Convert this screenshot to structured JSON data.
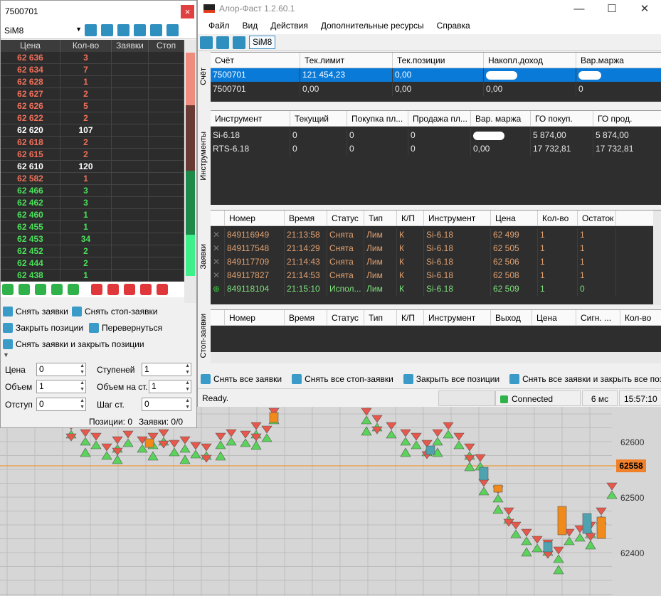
{
  "dom": {
    "title": "7500701",
    "close": "×",
    "symbol": "SiM8",
    "headers": [
      "Цена",
      "Кол-во",
      "Заявки",
      "Стоп"
    ],
    "rows": [
      {
        "price": "62 636",
        "qty": "3",
        "side": "ask"
      },
      {
        "price": "62 634",
        "qty": "7",
        "side": "ask"
      },
      {
        "price": "62 628",
        "qty": "1",
        "side": "ask"
      },
      {
        "price": "62 627",
        "qty": "2",
        "side": "ask"
      },
      {
        "price": "62 626",
        "qty": "5",
        "side": "ask"
      },
      {
        "price": "62 622",
        "qty": "2",
        "side": "ask"
      },
      {
        "price": "62 620",
        "qty": "107",
        "side": "big"
      },
      {
        "price": "62 618",
        "qty": "2",
        "side": "ask"
      },
      {
        "price": "62 615",
        "qty": "2",
        "side": "ask"
      },
      {
        "price": "62 610",
        "qty": "120",
        "side": "big"
      },
      {
        "price": "62 582",
        "qty": "1",
        "side": "ask"
      },
      {
        "price": "62 466",
        "qty": "3",
        "side": "bid"
      },
      {
        "price": "62 462",
        "qty": "3",
        "side": "bid"
      },
      {
        "price": "62 460",
        "qty": "1",
        "side": "bid"
      },
      {
        "price": "62 455",
        "qty": "1",
        "side": "bid"
      },
      {
        "price": "62 453",
        "qty": "34",
        "side": "bid"
      },
      {
        "price": "62 452",
        "qty": "2",
        "side": "bid"
      },
      {
        "price": "62 444",
        "qty": "2",
        "side": "bid"
      },
      {
        "price": "62 438",
        "qty": "1",
        "side": "bid"
      }
    ],
    "actions": {
      "cancel_orders": "Снять заявки",
      "cancel_stops": "Снять стоп-заявки",
      "close_positions": "Закрыть позиции",
      "reverse": "Перевернуться",
      "cancel_and_close": "Снять заявки и закрыть позиции"
    },
    "params": {
      "price_label": "Цена",
      "price": "0",
      "volume_label": "Объем",
      "volume": "1",
      "offset_label": "Отступ",
      "offset": "0",
      "steps_label": "Ступеней",
      "steps": "1",
      "vol_step_label": "Объем на ст.",
      "vol_step": "1",
      "step_label": "Шаг ст.",
      "step": "0"
    },
    "footer": {
      "positions": "Позиции: 0",
      "orders": "Заявки: 0/0"
    }
  },
  "main": {
    "title": "Алор-Фаст 1.2.60.1",
    "win_min": "—",
    "win_max": "☐",
    "win_close": "✕",
    "menu": [
      "Файл",
      "Вид",
      "Действия",
      "Дополнительные ресурсы",
      "Справка"
    ],
    "toolbar_symbol": "SiM8",
    "accounts": {
      "side_label": "Счёт",
      "headers": [
        "Счёт",
        "Тек.лимит",
        "Тек.позиции",
        "Накопл.доход",
        "Вар.маржа"
      ],
      "rows": [
        [
          "7500701",
          "121 454,23",
          "0,00",
          "",
          ""
        ],
        [
          "7500701",
          "0,00",
          "0,00",
          "0,00",
          "0"
        ]
      ]
    },
    "instruments": {
      "side_label": "Инструменты",
      "headers": [
        "Инструмент",
        "Текущий",
        "Покупка пл...",
        "Продажа пл...",
        "Вар. маржа",
        "ГО покуп.",
        "ГО прод."
      ],
      "rows": [
        [
          "Si-6.18",
          "0",
          "0",
          "0",
          "",
          "5 874,00",
          "5 874,00"
        ],
        [
          "RTS-6.18",
          "0",
          "0",
          "0",
          "0,00",
          "17 732,81",
          "17 732,81"
        ]
      ]
    },
    "orders": {
      "side_label": "Заявки",
      "headers": [
        "Номер",
        "Время",
        "Статус",
        "Тип",
        "К/П",
        "Инструмент",
        "Цена",
        "Кол-во",
        "Остаток"
      ],
      "rows": [
        [
          "849116949",
          "21:13:58",
          "Снята",
          "Лим",
          "К",
          "Si-6.18",
          "62 499",
          "1",
          "1"
        ],
        [
          "849117548",
          "21:14:29",
          "Снята",
          "Лим",
          "К",
          "Si-6.18",
          "62 505",
          "1",
          "1"
        ],
        [
          "849117709",
          "21:14:43",
          "Снята",
          "Лим",
          "К",
          "Si-6.18",
          "62 506",
          "1",
          "1"
        ],
        [
          "849117827",
          "21:14:53",
          "Снята",
          "Лим",
          "К",
          "Si-6.18",
          "62 508",
          "1",
          "1"
        ],
        [
          "849118104",
          "21:15:10",
          "Испол...",
          "Лим",
          "К",
          "Si-6.18",
          "62 509",
          "1",
          "0"
        ]
      ]
    },
    "stop_orders": {
      "side_label": "Стоп-заявки",
      "headers": [
        "Номер",
        "Время",
        "Статус",
        "Тип",
        "К/П",
        "Инструмент",
        "Выход",
        "Цена",
        "Сигн. ...",
        "Кол-во"
      ]
    },
    "bottom_actions": [
      "Снять все заявки",
      "Снять все стоп-заявки",
      "Закрыть все позиции",
      "Снять все заявки и закрыть все позиции"
    ],
    "status": {
      "ready": "Ready.",
      "connection": "Connected",
      "latency": "6 мс",
      "time": "15:57:10"
    }
  },
  "chart": {
    "price_labels": [
      "62600",
      "62500",
      "62400"
    ],
    "current_price": "62558",
    "colors": {
      "up": "#5ad35a",
      "down": "#e8574a",
      "body_up": "#4fa3b0",
      "body_down": "#f08a1a",
      "line": "#f08a1a"
    }
  }
}
